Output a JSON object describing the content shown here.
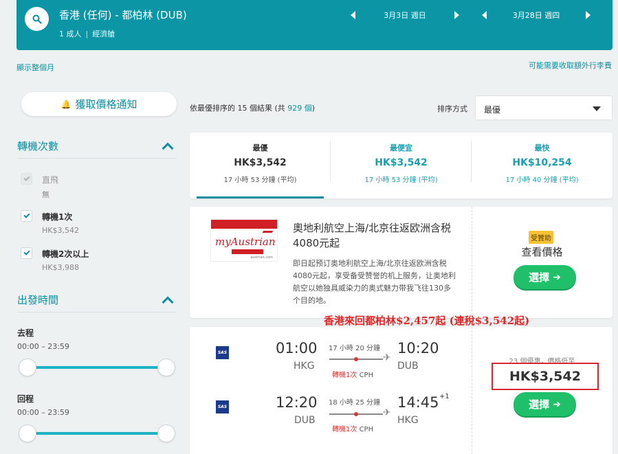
{
  "header": {
    "route": "香港 (任何) - 都柏林 (DUB)",
    "passengers": "1 成人",
    "cabin": "經濟艙",
    "depart_date": "3月3日 週日",
    "return_date": "3月28日 週四"
  },
  "links": {
    "show_month": "顯示整個月",
    "extra_fees": "可能需要收取額外行李費"
  },
  "sidebar": {
    "alert_label": "獲取價格通知",
    "stops_title": "轉機次數",
    "stops": [
      {
        "label": "直飛",
        "price": "無",
        "checked": true,
        "disabled": true
      },
      {
        "label": "轉機1次",
        "price": "HK$3,542",
        "checked": true,
        "disabled": false
      },
      {
        "label": "轉機2次以上",
        "price": "HK$3,988",
        "checked": true,
        "disabled": false
      }
    ],
    "time_title": "出發時間",
    "outbound_label": "去程",
    "outbound_range": "00:00 – 23:59",
    "return_label": "回程",
    "return_range": "00:00 – 23:59"
  },
  "results": {
    "count_prefix": "依最優排序的",
    "count": "15",
    "count_mid": "個結果 (共",
    "total": "929 個",
    "count_suffix": ")",
    "sort_label": "排序方式",
    "sort_value": "最優"
  },
  "tabs": [
    {
      "title": "最優",
      "price": "HK$3,542",
      "duration": "17 小時 53 分鐘 (平均)"
    },
    {
      "title": "最便宜",
      "price": "HK$3,542",
      "duration": "17 小時 53 分鐘 (平均)"
    },
    {
      "title": "最快",
      "price": "HK$10,254",
      "duration": "17 小時 40 分鐘 (平均)"
    }
  ],
  "ad": {
    "logo_text": "myAustrian",
    "logo_cn": "奧地利航空",
    "logo_url": "austrian.com",
    "title": "奧地利航空上海/北京往返欧洲含税4080元起",
    "body": "即日起预订奥地利航空上海/北京往返欧洲含税4080元起，享受备受赞誉的机上服务，让奥地利航空以她独具威染力的奥式魅力带我飞往130多个目的地。",
    "sponsor_badge": "受贊助",
    "view_price": "查看價格",
    "select_label": "選擇"
  },
  "promo_text": "香港來回都柏林$2,457起 (連稅$3,542起)",
  "flight": {
    "airline_logo": "SAS",
    "legs": [
      {
        "depart_time": "01:00",
        "depart_airport": "HKG",
        "duration": "17 小時 20 分鐘",
        "arrive_time": "10:20",
        "arrive_airport": "DUB",
        "stops_label": "轉機1次",
        "via": "CPH",
        "day_plus": ""
      },
      {
        "depart_time": "12:20",
        "depart_airport": "DUB",
        "duration": "18 小時 25 分鐘",
        "arrive_time": "14:45",
        "arrive_airport": "HKG",
        "stops_label": "轉機1次",
        "via": "CPH",
        "day_plus": "+1"
      }
    ],
    "deals_text": "23 個優惠，價格低至",
    "price": "HK$3,542",
    "select_label": "選擇"
  },
  "icons": {
    "search": "search-icon",
    "bell": "bell-icon",
    "plane": "plane-icon"
  },
  "colors": {
    "brand": "#0b95a5",
    "accent_text": "#0a8fa0",
    "select_button": "#20c06a",
    "promo": "#e02626"
  }
}
